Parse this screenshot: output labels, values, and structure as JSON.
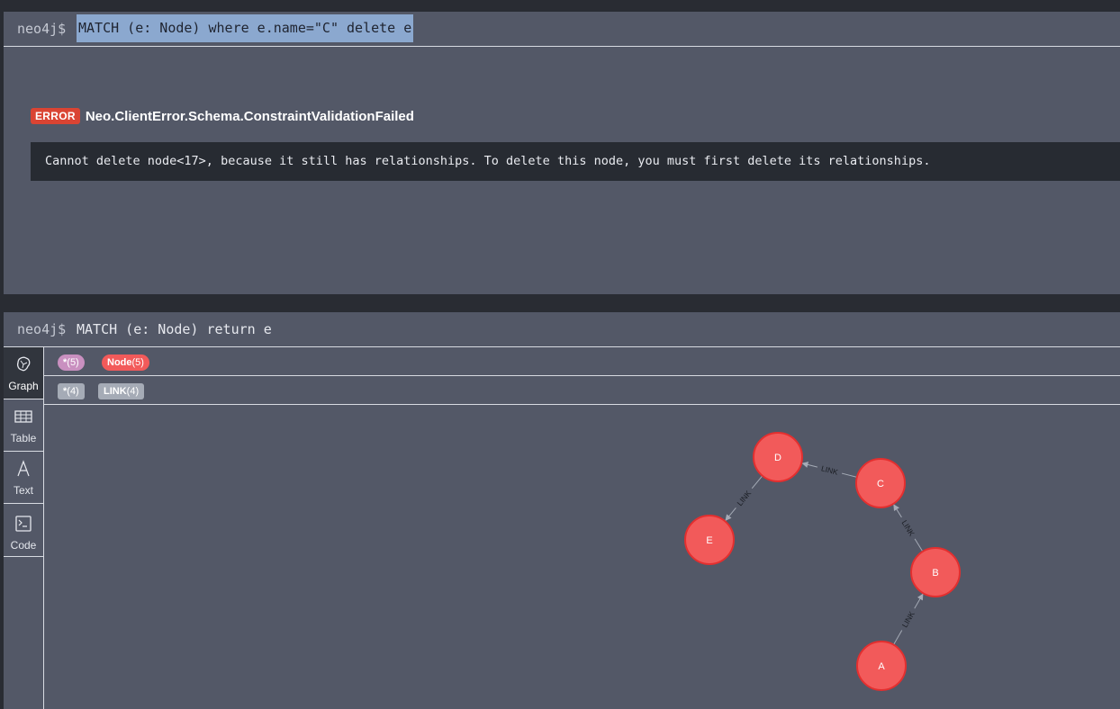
{
  "frame1": {
    "prompt": "neo4j$",
    "query": "MATCH (e: Node) where e.name=\"C\" delete e",
    "error": {
      "badge": "ERROR",
      "code": "Neo.ClientError.Schema.ConstraintValidationFailed",
      "message": "Cannot delete node<17>, because it still has relationships. To delete this node, you must first delete its relationships."
    }
  },
  "frame2": {
    "prompt": "neo4j$",
    "query": "MATCH (e: Node) return e",
    "sidebar": [
      {
        "label": "Graph",
        "icon": "graph-icon"
      },
      {
        "label": "Table",
        "icon": "table-icon"
      },
      {
        "label": "Text",
        "icon": "text-icon"
      },
      {
        "label": "Code",
        "icon": "code-icon"
      }
    ],
    "node_labels": [
      {
        "name": "*",
        "count": "(5)",
        "color": "#c990c0"
      },
      {
        "name": "Node",
        "count": "(5)",
        "color": "#f25a5a"
      }
    ],
    "rel_types": [
      {
        "name": "*",
        "count": "(4)",
        "color": "#a5abb6"
      },
      {
        "name": "LINK",
        "count": "(4)",
        "color": "#a5abb6"
      }
    ],
    "graph": {
      "node_color": "#f25a5a",
      "node_border": "#e32f2f",
      "nodes": [
        {
          "id": "D",
          "label": "D"
        },
        {
          "id": "C",
          "label": "C"
        },
        {
          "id": "E",
          "label": "E"
        },
        {
          "id": "B",
          "label": "B"
        },
        {
          "id": "A",
          "label": "A"
        }
      ],
      "relationships": [
        {
          "from": "C",
          "to": "D",
          "type": "LINK"
        },
        {
          "from": "D",
          "to": "E",
          "type": "LINK"
        },
        {
          "from": "B",
          "to": "C",
          "type": "LINK"
        },
        {
          "from": "A",
          "to": "B",
          "type": "LINK"
        }
      ]
    }
  }
}
